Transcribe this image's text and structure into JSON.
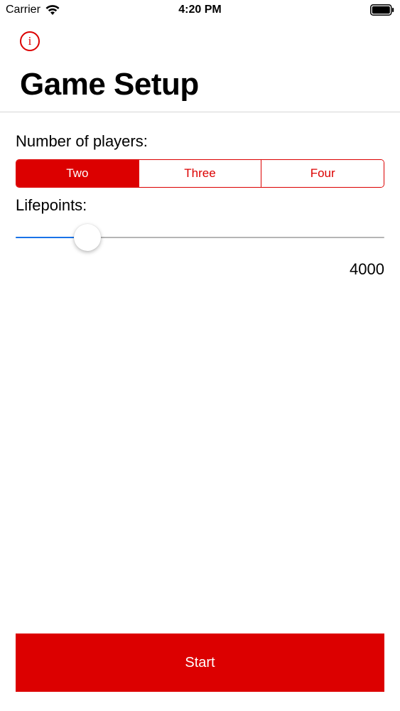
{
  "status_bar": {
    "carrier": "Carrier",
    "time": "4:20 PM",
    "wifi_icon": "wifi-icon",
    "battery_icon": "battery-icon"
  },
  "header": {
    "info_icon": "info-icon",
    "info_glyph": "i",
    "title": "Game Setup"
  },
  "players": {
    "label": "Number of players:",
    "options": [
      "Two",
      "Three",
      "Four"
    ],
    "selected_index": 0
  },
  "lifepoints": {
    "label": "Lifepoints:",
    "value": "4000",
    "slider_fraction": 0.17
  },
  "start_button": {
    "label": "Start"
  },
  "colors": {
    "accent": "#dc0000",
    "slider_fill": "#1a73e8",
    "slider_track": "#b5b5b5"
  }
}
